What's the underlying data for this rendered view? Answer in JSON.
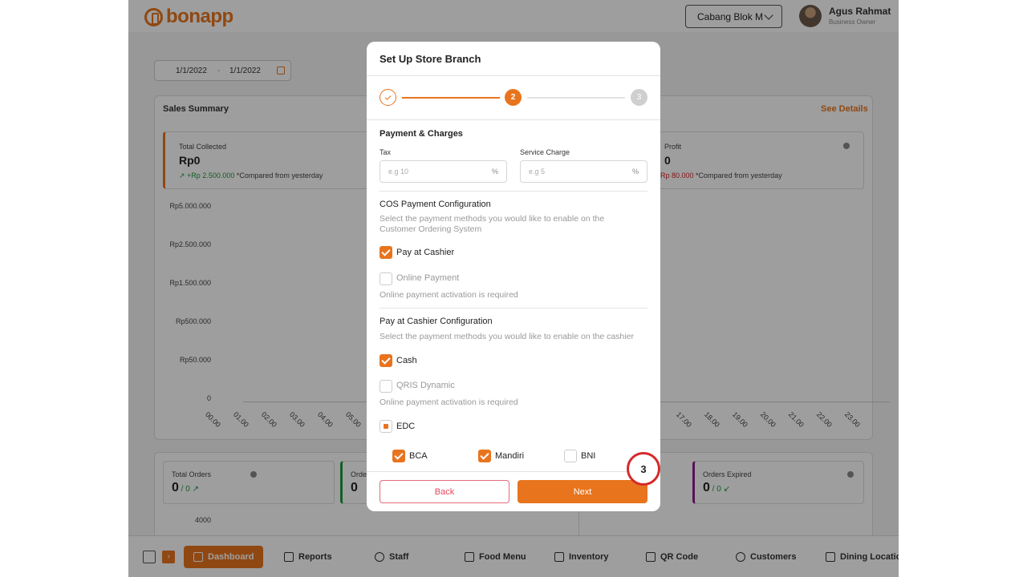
{
  "header": {
    "logo_text": "bonapp",
    "branch_select": "Cabang Blok M",
    "user_name": "Agus Rahmat",
    "user_role": "Business Owner"
  },
  "dashboard": {
    "date_from": "1/1/2022",
    "date_sep": "-",
    "date_to": "1/1/2022",
    "sales_summary_title": "Sales Summary",
    "see_details": "See Details",
    "kpi_total_collected": {
      "label": "Total Collected",
      "value": "Rp0",
      "change": "+Rp 2.500.000",
      "note": "*Compared from yesterday"
    },
    "kpi_profit": {
      "label": "Profit",
      "value": "0",
      "change": "-Rp 80.000",
      "note": "*Compared from yesterday"
    },
    "y_ticks": [
      "Rp5.000.000",
      "Rp2.500.000",
      "Rp1.500.000",
      "Rp500.000",
      "Rp50.000",
      "0"
    ],
    "x_ticks_left": [
      "00.00",
      "01.00",
      "02.00",
      "03.00",
      "04.00",
      "05.00"
    ],
    "x_ticks_right": [
      "17.00",
      "18.00",
      "19.00",
      "20.00",
      "21.00",
      "22.00",
      "23.00"
    ],
    "orders": {
      "total_orders_label": "Total Orders",
      "total_orders_value": "0",
      "total_orders_sub": "0",
      "order_label_cut": "Orde",
      "order_value_cut": "0",
      "orders_expired_label": "Orders Expired",
      "orders_expired_value": "0",
      "orders_expired_sub": "0",
      "chart_tick": "4000"
    }
  },
  "bottom_nav": {
    "items": [
      "Dashboard",
      "Reports",
      "Staff",
      "Food Menu",
      "Inventory",
      "QR Code",
      "Customers",
      "Dining Locatio"
    ]
  },
  "modal": {
    "title": "Set Up Store Branch",
    "steps": [
      "1",
      "2",
      "3"
    ],
    "current_step": 2,
    "payment_charges_title": "Payment & Charges",
    "tax_label": "Tax",
    "tax_placeholder": "e.g 10",
    "tax_suffix": "%",
    "service_label": "Service Charge",
    "service_placeholder": "e.g 5",
    "service_suffix": "%",
    "cos_title": "COS Payment Configuration",
    "cos_desc": "Select the payment methods you would like to enable on the Customer Ordering System",
    "pay_at_cashier": "Pay at Cashier",
    "online_payment": "Online Payment",
    "online_required": "Online payment activation is required",
    "cashier_title": "Pay at Cashier Configuration",
    "cashier_desc": "Select the payment methods you would like to enable on the cashier",
    "cash": "Cash",
    "qris": "QRIS Dynamic",
    "qris_required": "Online payment activation is required",
    "edc": "EDC",
    "bca": "BCA",
    "mandiri": "Mandiri",
    "bni": "BNI",
    "back": "Back",
    "next": "Next"
  },
  "annotation": {
    "label": "3"
  },
  "colors": {
    "accent": "#e8741e",
    "danger": "#d42a2a",
    "success": "#1e9a3c"
  }
}
